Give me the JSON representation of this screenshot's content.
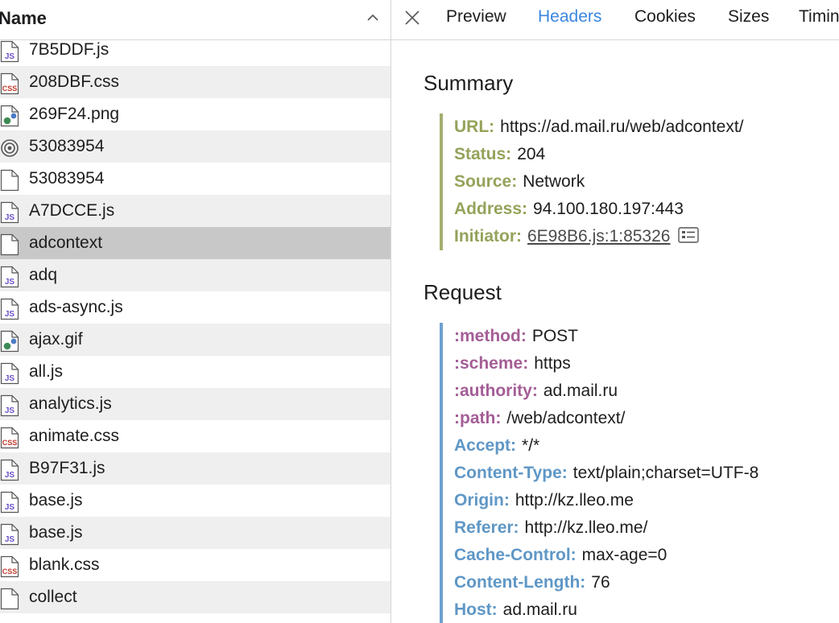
{
  "left_panel": {
    "column_title": "Name",
    "files": [
      {
        "name": "7B5DDF.js",
        "type": "js",
        "selected": false
      },
      {
        "name": "208DBF.css",
        "type": "css",
        "selected": false
      },
      {
        "name": "269F24.png",
        "type": "image",
        "selected": false
      },
      {
        "name": "53083954",
        "type": "target",
        "selected": false
      },
      {
        "name": "53083954",
        "type": "blank",
        "selected": false
      },
      {
        "name": "A7DCCE.js",
        "type": "js",
        "selected": false
      },
      {
        "name": "adcontext",
        "type": "blank",
        "selected": true
      },
      {
        "name": "adq",
        "type": "js",
        "selected": false
      },
      {
        "name": "ads-async.js",
        "type": "js",
        "selected": false
      },
      {
        "name": "ajax.gif",
        "type": "image",
        "selected": false
      },
      {
        "name": "all.js",
        "type": "js",
        "selected": false
      },
      {
        "name": "analytics.js",
        "type": "js",
        "selected": false
      },
      {
        "name": "animate.css",
        "type": "css",
        "selected": false
      },
      {
        "name": "B97F31.js",
        "type": "js",
        "selected": false
      },
      {
        "name": "base.js",
        "type": "js",
        "selected": false
      },
      {
        "name": "base.js",
        "type": "js",
        "selected": false
      },
      {
        "name": "blank.css",
        "type": "css",
        "selected": false
      },
      {
        "name": "collect",
        "type": "blank",
        "selected": false
      }
    ],
    "icon_badges": {
      "js": "JS",
      "css": "CSS"
    }
  },
  "tabs": [
    {
      "label": "Preview",
      "active": false
    },
    {
      "label": "Headers",
      "active": true
    },
    {
      "label": "Cookies",
      "active": false
    },
    {
      "label": "Sizes",
      "active": false
    },
    {
      "label": "Timing",
      "active": false
    }
  ],
  "summary": {
    "title": "Summary",
    "rows": [
      {
        "key": "URL:",
        "value": "https://ad.mail.ru/web/adcontext/"
      },
      {
        "key": "Status:",
        "value": "204"
      },
      {
        "key": "Source:",
        "value": "Network"
      },
      {
        "key": "Address:",
        "value": "94.100.180.197:443"
      },
      {
        "key": "Initiator:",
        "value": "6E98B6.js:1:85326",
        "link": true
      }
    ]
  },
  "request": {
    "title": "Request",
    "rows": [
      {
        "key": ":method:",
        "value": "POST",
        "kind": "pseudo"
      },
      {
        "key": ":scheme:",
        "value": "https",
        "kind": "pseudo"
      },
      {
        "key": ":authority:",
        "value": "ad.mail.ru",
        "kind": "pseudo"
      },
      {
        "key": ":path:",
        "value": "/web/adcontext/",
        "kind": "pseudo"
      },
      {
        "key": "Accept:",
        "value": "*/*",
        "kind": "header"
      },
      {
        "key": "Content-Type:",
        "value": "text/plain;charset=UTF-8",
        "kind": "header"
      },
      {
        "key": "Origin:",
        "value": "http://kz.lleo.me",
        "kind": "header"
      },
      {
        "key": "Referer:",
        "value": "http://kz.lleo.me/",
        "kind": "header"
      },
      {
        "key": "Cache-Control:",
        "value": "max-age=0",
        "kind": "header"
      },
      {
        "key": "Content-Length:",
        "value": "76",
        "kind": "header"
      },
      {
        "key": "Host:",
        "value": "ad.mail.ru",
        "kind": "header"
      }
    ]
  },
  "colors": {
    "summary_key": "#94a35a",
    "pseudo_key": "#a45e96",
    "header_key": "#5f97c6",
    "active_tab": "#3a87e0",
    "selected_row": "#c8c8c8"
  }
}
